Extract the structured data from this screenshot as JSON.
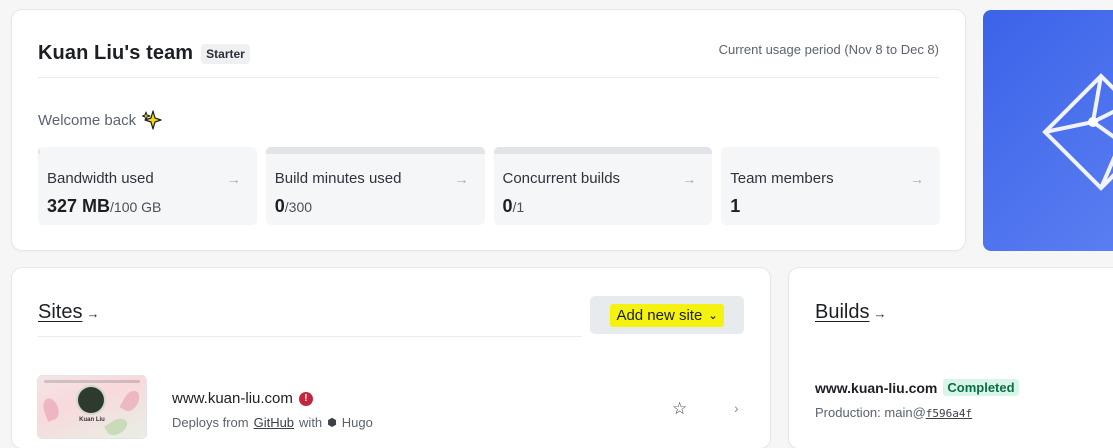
{
  "team": {
    "name": "Kuan Liu's team",
    "plan": "Starter",
    "usage_period": "Current usage period (Nov 8 to Dec 8)",
    "welcome": "Welcome back",
    "stats": [
      {
        "label": "Bandwidth used",
        "value": "327 MB",
        "limit": "/100 GB",
        "usage_fraction": 0.003
      },
      {
        "label": "Build minutes used",
        "value": "0",
        "limit": "/300",
        "usage_fraction": 0
      },
      {
        "label": "Concurrent builds",
        "value": "0",
        "limit": "/1",
        "usage_fraction": 0
      },
      {
        "label": "Team members",
        "value": "1",
        "limit": "",
        "usage_fraction": 0
      }
    ]
  },
  "sites": {
    "title": "Sites",
    "add_button": "Add new site",
    "items": [
      {
        "name": "www.kuan-liu.com",
        "deploy_prefix": "Deploys from",
        "deploy_source": "GitHub",
        "deploy_with": "with",
        "framework": "Hugo",
        "thumb_name": "Kuan Liu"
      }
    ]
  },
  "builds": {
    "title": "Builds",
    "items": [
      {
        "site": "www.kuan-liu.com",
        "status": "Completed",
        "context": "Production:",
        "branch": "main@",
        "commit": "f596a4f"
      }
    ]
  },
  "colors": {
    "brand_blue": "#3b63e8",
    "highlight": "#f4f20e",
    "alert_red": "#c2253d",
    "success_green": "#0b6d45"
  }
}
